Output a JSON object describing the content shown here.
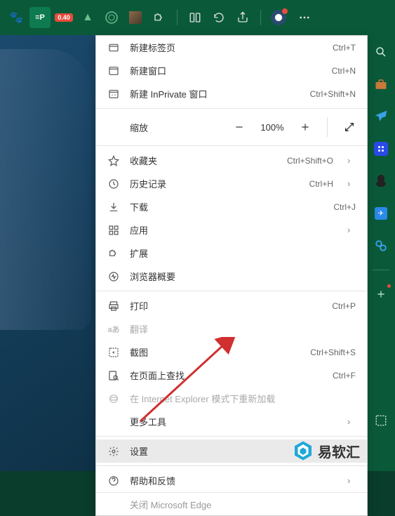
{
  "topbar": {
    "badge": "0.40"
  },
  "menu": {
    "new_tab": "新建标签页",
    "new_tab_sc": "Ctrl+T",
    "new_window": "新建窗口",
    "new_window_sc": "Ctrl+N",
    "new_inprivate": "新建 InPrivate 窗口",
    "new_inprivate_sc": "Ctrl+Shift+N",
    "zoom": "缩放",
    "zoom_pct": "100%",
    "favorites": "收藏夹",
    "favorites_sc": "Ctrl+Shift+O",
    "history": "历史记录",
    "history_sc": "Ctrl+H",
    "downloads": "下载",
    "downloads_sc": "Ctrl+J",
    "apps": "应用",
    "extensions": "扩展",
    "browser_task": "浏览器概要",
    "print": "打印",
    "print_sc": "Ctrl+P",
    "translate": "翻译",
    "screenshot": "截图",
    "screenshot_sc": "Ctrl+Shift+S",
    "find": "在页面上查找",
    "find_sc": "Ctrl+F",
    "ie_mode": "在 Internet Explorer 模式下重新加载",
    "more_tools": "更多工具",
    "settings": "设置",
    "help": "帮助和反馈",
    "close_edge": "关闭 Microsoft Edge"
  },
  "watermark": {
    "text": "易软汇"
  }
}
